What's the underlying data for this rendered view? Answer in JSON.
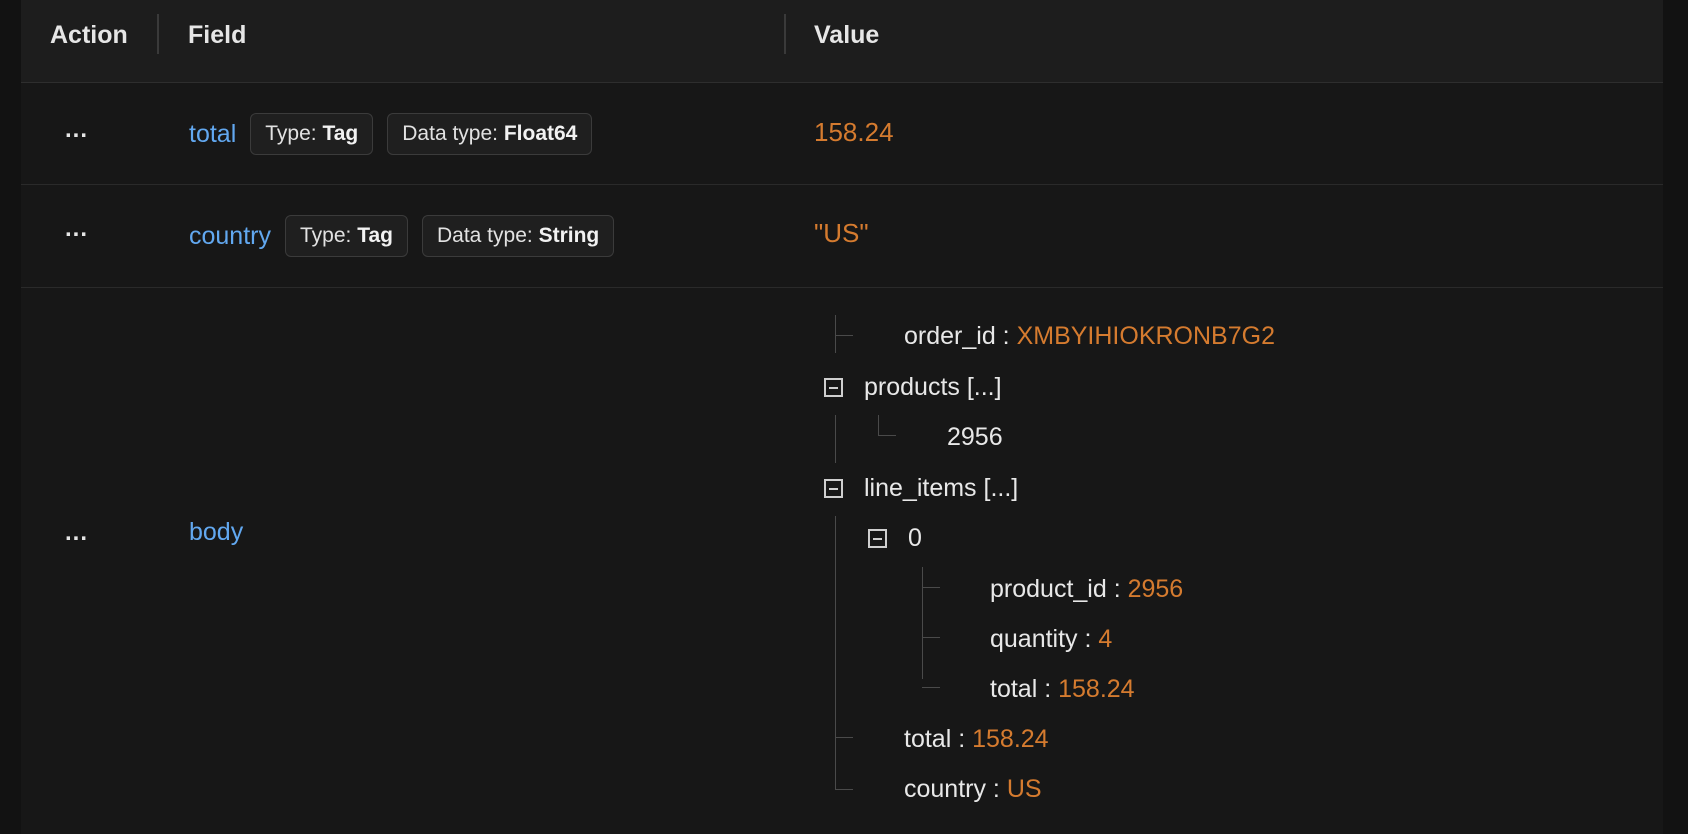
{
  "headers": {
    "action": "Action",
    "field": "Field",
    "value": "Value"
  },
  "rows": [
    {
      "action": "...",
      "field": "total",
      "type_label": "Type:",
      "type_value": "Tag",
      "dtype_label": "Data type:",
      "dtype_value": "Float64",
      "value": "158.24"
    },
    {
      "action": "...",
      "field": "country",
      "type_label": "Type:",
      "type_value": "Tag",
      "dtype_label": "Data type:",
      "dtype_value": "String",
      "value": "\"US\""
    },
    {
      "action": "...",
      "field": "body"
    }
  ],
  "tree": {
    "order_id_key": "order_id :",
    "order_id_val": "XMBYIHIOKRONB7G2",
    "products_key": "products [...]",
    "products_item": "2956",
    "line_items_key": "line_items [...]",
    "line_item_index": "0",
    "product_id_key": "product_id :",
    "product_id_val": "2956",
    "quantity_key": "quantity :",
    "quantity_val": "4",
    "item_total_key": "total :",
    "item_total_val": "158.24",
    "total_key": "total :",
    "total_val": "158.24",
    "country_key": "country :",
    "country_val": "US"
  },
  "colors": {
    "field_name": "#62a8f0",
    "value": "#d57b2f",
    "background": "#171717"
  }
}
